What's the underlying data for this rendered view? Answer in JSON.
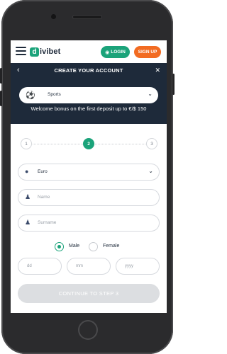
{
  "colors": {
    "brand_green": "#1ba37a",
    "brand_orange": "#f26b21",
    "navy": "#1e2a3a",
    "disabled": "#dcdee1"
  },
  "header": {
    "logo_mark": "d",
    "logo_text": "ivibet",
    "login_icon": "user-icon",
    "login_label": "LOGIN",
    "signup_label": "SIGN UP"
  },
  "modal": {
    "title": "CREATE YOUR ACCOUNT",
    "sport": {
      "icon": "soccer-ball-icon",
      "value": "Sports"
    },
    "bonus_text": "Welcome bonus on the first deposit up to €/$ 150"
  },
  "steps": {
    "items": [
      "1",
      "2",
      "3"
    ],
    "current": 2
  },
  "form": {
    "currency": {
      "icon": "coins-icon",
      "value": "Euro"
    },
    "name": {
      "icon": "user-icon",
      "placeholder": "Name"
    },
    "surname": {
      "icon": "user-icon",
      "placeholder": "Surname"
    },
    "gender": {
      "male_label": "Male",
      "female_label": "Female",
      "selected": "Male"
    },
    "birth": {
      "day_placeholder": "dd",
      "month_placeholder": "mm",
      "year_placeholder": "yyyy"
    },
    "continue_label": "CONTINUE TO STEP 3"
  }
}
